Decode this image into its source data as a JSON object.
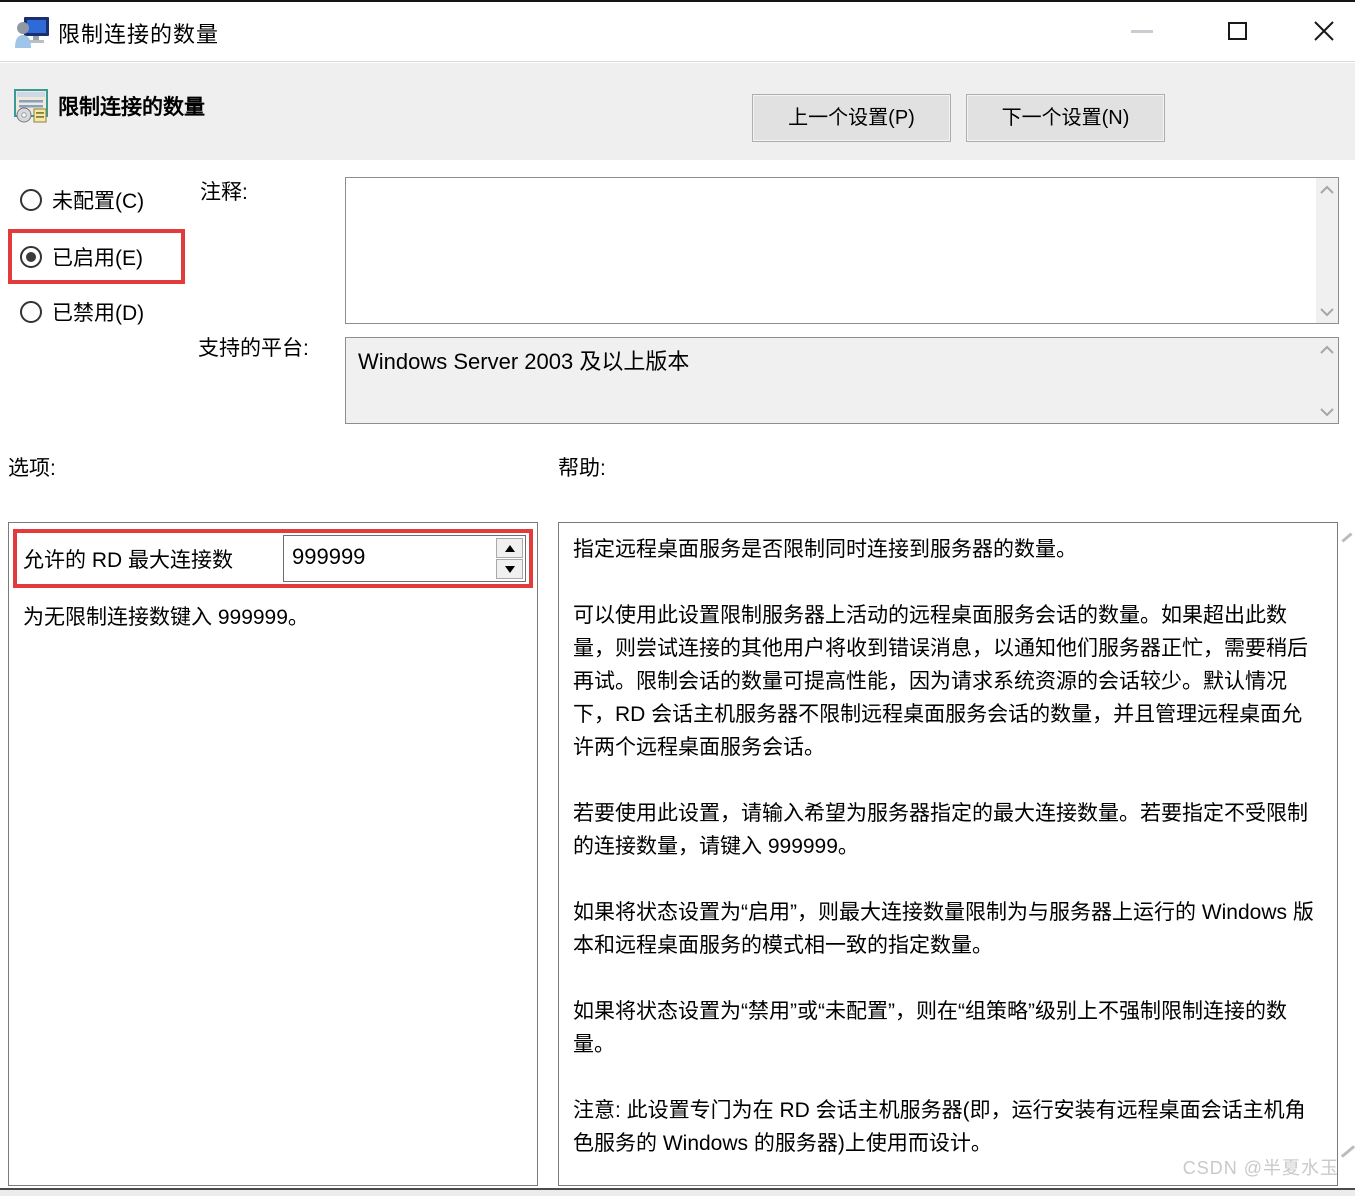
{
  "window": {
    "title": "限制连接的数量"
  },
  "header": {
    "policy_name": "限制连接的数量",
    "prev_button": "上一个设置(P)",
    "next_button": "下一个设置(N)"
  },
  "state": {
    "not_configured": "未配置(C)",
    "enabled": "已启用(E)",
    "disabled": "已禁用(D)",
    "selected": "已启用(E)"
  },
  "comment": {
    "label": "注释:",
    "value": ""
  },
  "supported_on": {
    "label": "支持的平台:",
    "value": "Windows Server 2003 及以上版本"
  },
  "options": {
    "label": "选项:",
    "max_connections_label": "允许的 RD 最大连接数",
    "max_connections_value": "999999",
    "hint": "为无限制连接数键入 999999。"
  },
  "help": {
    "label": "帮助:",
    "paragraphs": [
      "指定远程桌面服务是否限制同时连接到服务器的数量。",
      "可以使用此设置限制服务器上活动的远程桌面服务会话的数量。如果超出此数量，则尝试连接的其他用户将收到错误消息，以通知他们服务器正忙，需要稍后再试。限制会话的数量可提高性能，因为请求系统资源的会话较少。默认情况下，RD 会话主机服务器不限制远程桌面服务会话的数量，并且管理远程桌面允许两个远程桌面服务会话。",
      "若要使用此设置，请输入希望为服务器指定的最大连接数量。若要指定不受限制的连接数量，请键入 999999。",
      "如果将状态设置为“启用”，则最大连接数量限制为与服务器上运行的 Windows 版本和远程桌面服务的模式相一致的指定数量。",
      "如果将状态设置为“禁用”或“未配置”，则在“组策略”级别上不强制限制连接的数量。",
      "注意: 此设置专门为在 RD 会话主机服务器(即，运行安装有远程桌面会话主机角色服务的 Windows 的服务器)上使用而设计。"
    ]
  },
  "watermark": "CSDN @半夏水玉",
  "colors": {
    "annotation_red": "#e23b3b",
    "header_band": "#efefef",
    "button_face": "#e1e1e1",
    "readonly_field": "#f0f0f0"
  }
}
